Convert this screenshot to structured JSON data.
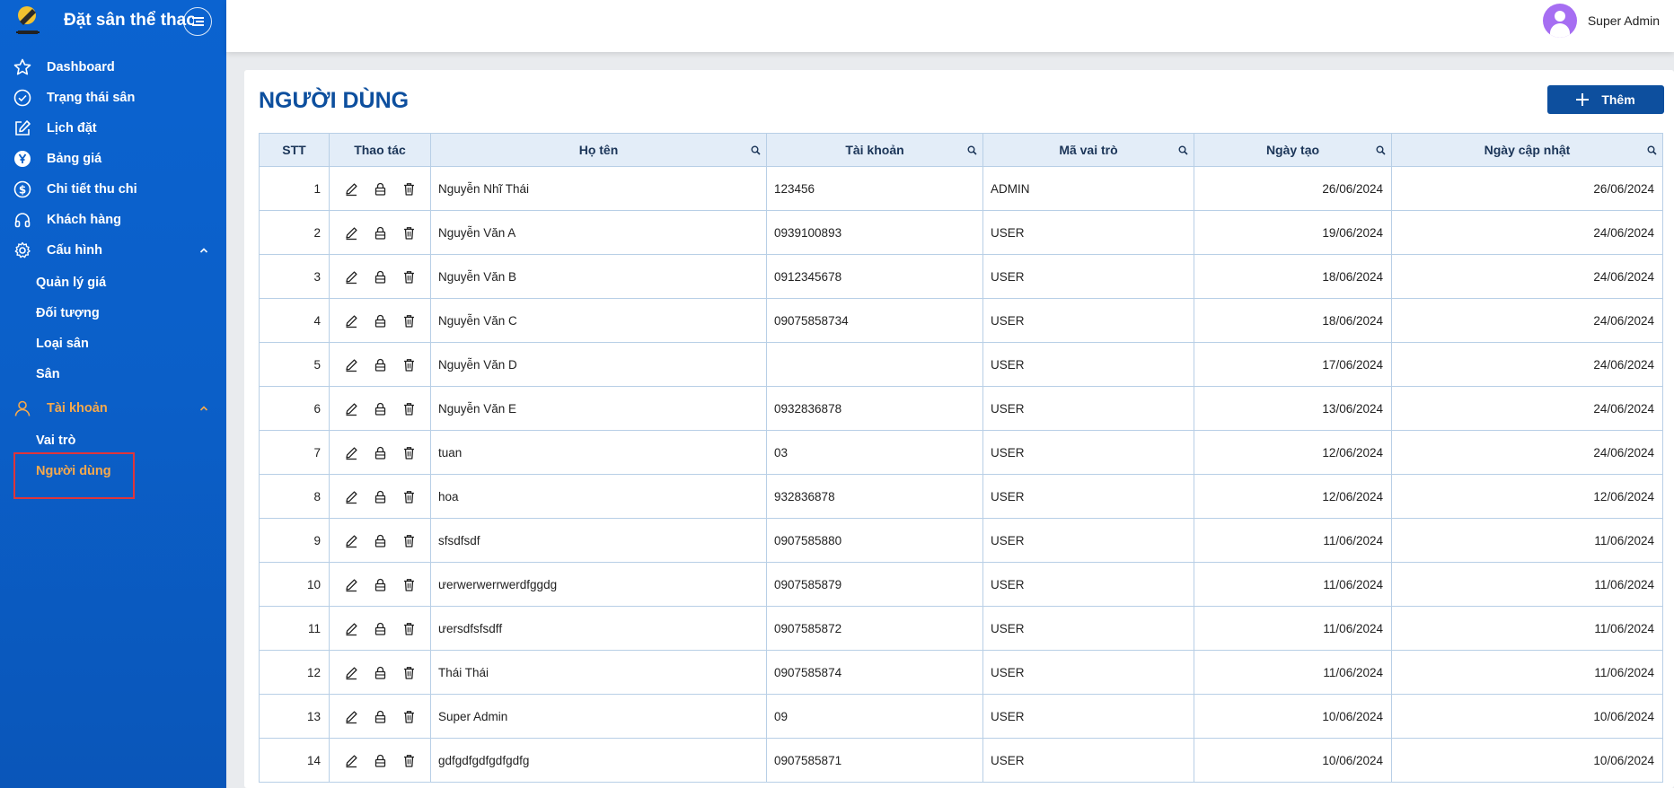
{
  "brand": {
    "title": "Đặt sân thể thao"
  },
  "sidebar": {
    "items": [
      {
        "label": "Dashboard",
        "icon": "star-icon"
      },
      {
        "label": "Trạng thái sân",
        "icon": "check-circle-icon"
      },
      {
        "label": "Lịch đặt",
        "icon": "edit-icon"
      },
      {
        "label": "Bảng giá",
        "icon": "yen-circle-icon"
      },
      {
        "label": "Chi tiết thu chi",
        "icon": "dollar-circle-icon"
      },
      {
        "label": "Khách hàng",
        "icon": "headphones-icon"
      },
      {
        "label": "Cấu hình",
        "icon": "gear-icon"
      }
    ],
    "config_sub": [
      "Quản lý giá",
      "Đối tượng",
      "Loại sân",
      "Sân"
    ],
    "account": {
      "label": "Tài khoản",
      "icon": "user-icon"
    },
    "account_sub": [
      "Vai trò",
      "Người dùng"
    ],
    "active_color": "#f6a94c"
  },
  "topbar": {
    "user_name": "Super Admin"
  },
  "page": {
    "title": "NGƯỜI DÙNG",
    "add_label": "Thêm"
  },
  "table": {
    "headers": [
      "STT",
      "Thao tác",
      "Họ tên",
      "Tài khoản",
      "Mã vai trò",
      "Ngày tạo",
      "Ngày cập nhật"
    ],
    "rows": [
      [
        "1",
        "Nguyễn Nhĩ Thái",
        "123456",
        "ADMIN",
        "26/06/2024",
        "26/06/2024"
      ],
      [
        "2",
        "Nguyễn Văn A",
        "0939100893",
        "USER",
        "19/06/2024",
        "24/06/2024"
      ],
      [
        "3",
        "Nguyễn Văn B",
        "0912345678",
        "USER",
        "18/06/2024",
        "24/06/2024"
      ],
      [
        "4",
        "Nguyễn Văn C",
        "09075858734",
        "USER",
        "18/06/2024",
        "24/06/2024"
      ],
      [
        "5",
        "Nguyễn Văn D",
        "",
        "USER",
        "17/06/2024",
        "24/06/2024"
      ],
      [
        "6",
        "Nguyễn Văn E",
        "0932836878",
        "USER",
        "13/06/2024",
        "24/06/2024"
      ],
      [
        "7",
        "tuan",
        "03",
        "USER",
        "12/06/2024",
        "24/06/2024"
      ],
      [
        "8",
        "hoa",
        "932836878",
        "USER",
        "12/06/2024",
        "12/06/2024"
      ],
      [
        "9",
        "sfsdfsdf",
        "0907585880",
        "USER",
        "11/06/2024",
        "11/06/2024"
      ],
      [
        "10",
        "ưerwerwerrwerdfggdg",
        "0907585879",
        "USER",
        "11/06/2024",
        "11/06/2024"
      ],
      [
        "11",
        "ưersdfsfsdff",
        "0907585872",
        "USER",
        "11/06/2024",
        "11/06/2024"
      ],
      [
        "12",
        "Thái Thái",
        "0907585874",
        "USER",
        "11/06/2024",
        "11/06/2024"
      ],
      [
        "13",
        "Super Admin",
        "09",
        "USER",
        "10/06/2024",
        "10/06/2024"
      ],
      [
        "14",
        "gdfgdfgdfgdfgdfg",
        "0907585871",
        "USER",
        "10/06/2024",
        "10/06/2024"
      ]
    ]
  },
  "colors": {
    "sidebar": "#0b5fc8",
    "primary": "#0d4f9e",
    "header_bg": "#e3edf8",
    "highlight_border": "#e0353a"
  }
}
